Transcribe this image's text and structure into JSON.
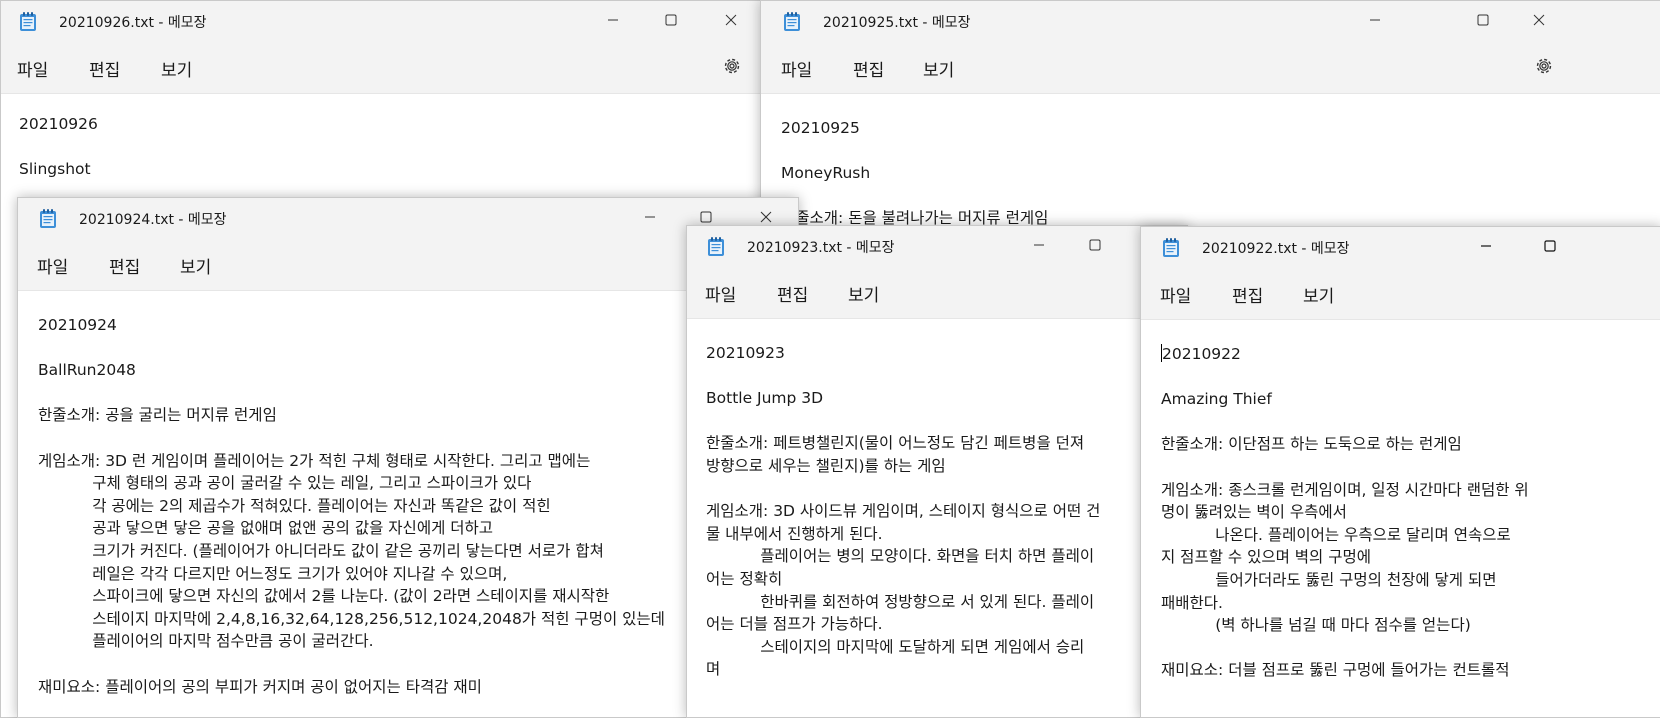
{
  "menu": {
    "file": "파일",
    "edit": "편집",
    "view": "보기"
  },
  "windows": [
    {
      "title": "20210926.txt - 메모장",
      "lines": [
        "20210926",
        "",
        "Slingshot"
      ]
    },
    {
      "title": "20210925.txt - 메모장",
      "lines": [
        "20210925",
        "",
        "MoneyRush",
        "",
        "한줄소개: 돈을 불려나가는 머지류 런게임"
      ]
    },
    {
      "title": "20210924.txt - 메모장",
      "lines": [
        "20210924",
        "",
        "BallRun2048",
        "",
        "한줄소개: 공을 굴리는 머지류 런게임",
        "",
        "게임소개: 3D 런 게임이며 플레이어는 2가 적힌 구체 형태로 시작한다. 그리고 맵에는",
        "           구체 형태의 공과 공이 굴러갈 수 있는 레일, 그리고 스파이크가 있다",
        "           각 공에는 2의 제곱수가 적혀있다. 플레이어는 자신과 똑같은 값이 적힌",
        "           공과 닿으면 닿은 공을 없애며 없앤 공의 값을 자신에게 더하고",
        "           크기가 커진다. (플레이어가 아니더라도 값이 같은 공끼리 닿는다면 서로가 합쳐",
        "           레일은 각각 다르지만 어느정도 크기가 있어야 지나갈 수 있으며,",
        "           스파이크에 닿으면 자신의 값에서 2를 나눈다. (값이 2라면 스테이지를 재시작한",
        "           스테이지 마지막에 2,4,8,16,32,64,128,256,512,1024,2048가 적힌 구멍이 있는데",
        "           플레이어의 마지막 점수만큼 공이 굴러간다.",
        "",
        "재미요소: 플레이어의 공의 부피가 커지며 공이 없어지는 타격감 재미"
      ]
    },
    {
      "title": "20210923.txt - 메모장",
      "lines": [
        "20210923",
        "",
        "Bottle Jump 3D",
        "",
        "한줄소개: 페트병챌린지(물이 어느정도 담긴 페트병을 던져",
        "방향으로 세우는 챌린지)를 하는 게임",
        "",
        "게임소개: 3D 사이드뷰 게임이며, 스테이지 형식으로 어떤 건",
        "물 내부에서 진행하게 된다.",
        "           플레이어는 병의 모양이다. 화면을 터치 하면 플레이",
        "어는 정확히",
        "           한바퀴를 회전하여 정방향으로 서 있게 된다. 플레이",
        "어는 더블 점프가 가능하다.",
        "           스테이지의 마지막에 도달하게 되면 게임에서 승리",
        "며"
      ]
    },
    {
      "title": "20210922.txt - 메모장",
      "lines": [
        "20210922",
        "",
        "Amazing Thief",
        "",
        "한줄소개: 이단점프 하는 도둑으로 하는 런게임",
        "",
        "게임소개: 종스크롤 런게임이며, 일정 시간마다 랜덤한 위",
        "명이 뚫려있는 벽이 우측에서",
        "           나온다. 플레이어는 우측으로 달리며 연속으로",
        "지 점프할 수 있으며 벽의 구멍에",
        "           들어가더라도 뚫린 구멍의 천장에 닿게 되면",
        "패배한다.",
        "           (벽 하나를 넘길 때 마다 점수를 얻는다)",
        "",
        "재미요소: 더블 점프로 뚫린 구멍에 들어가는 컨트롤적"
      ]
    }
  ]
}
